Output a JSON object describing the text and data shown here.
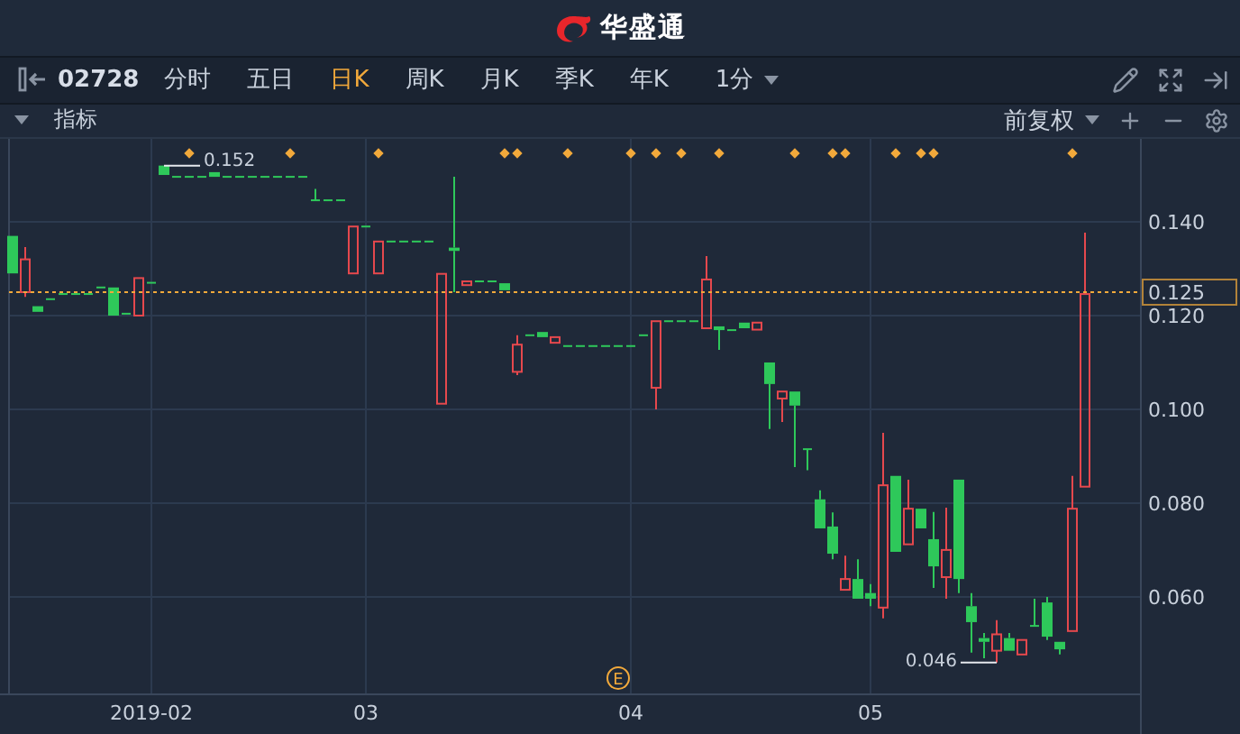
{
  "header": {
    "app_name": "华盛通"
  },
  "toolbar": {
    "symbol": "02728",
    "periods": [
      {
        "label": "分时",
        "selected": false
      },
      {
        "label": "五日",
        "selected": false
      },
      {
        "label": "日K",
        "selected": true
      },
      {
        "label": "周K",
        "selected": false
      },
      {
        "label": "月K",
        "selected": false
      },
      {
        "label": "季K",
        "selected": false
      },
      {
        "label": "年K",
        "selected": false
      }
    ],
    "interval": {
      "label": "1分"
    }
  },
  "indicator_bar": {
    "label": "指标",
    "adjustment": "前复权"
  },
  "chart": {
    "badge_label": "E",
    "chart_data": {
      "type": "candlestick",
      "grid": true,
      "ylim": [
        0.0392,
        0.1577
      ],
      "categories": [
        null,
        null,
        null,
        null,
        null,
        null,
        null,
        null,
        null,
        null,
        null,
        "2019-02",
        null,
        null,
        null,
        null,
        null,
        null,
        null,
        null,
        null,
        null,
        null,
        null,
        null,
        null,
        null,
        null,
        "03",
        null,
        null,
        null,
        null,
        null,
        null,
        null,
        null,
        null,
        null,
        null,
        null,
        null,
        null,
        null,
        null,
        null,
        null,
        null,
        null,
        "04",
        null,
        null,
        null,
        null,
        null,
        null,
        null,
        null,
        null,
        null,
        null,
        null,
        null,
        null,
        null,
        null,
        null,
        null,
        "05",
        null,
        null,
        null,
        null,
        null,
        null,
        null,
        null,
        null,
        null,
        null,
        null,
        null,
        null,
        null,
        null,
        null
      ],
      "yticks": [
        {
          "value": 0.06,
          "label": "0.060"
        },
        {
          "value": 0.08,
          "label": "0.080"
        },
        {
          "value": 0.1,
          "label": "0.100"
        },
        {
          "value": 0.12,
          "label": "0.120"
        },
        {
          "value": 0.14,
          "label": "0.140"
        }
      ],
      "ohlc": [
        [
          0.137,
          0.137,
          0.129,
          0.129
        ],
        [
          0.125,
          0.1346,
          0.124,
          0.132
        ],
        [
          0.122,
          0.122,
          0.1208,
          0.1208
        ],
        [
          0.1235,
          0.1235,
          0.1235,
          0.1235
        ],
        [
          0.1246,
          0.1246,
          0.1246,
          0.1246
        ],
        [
          0.1246,
          0.1246,
          0.1246,
          0.1246
        ],
        [
          0.1246,
          0.1246,
          0.1246,
          0.1246
        ],
        [
          0.126,
          0.126,
          0.126,
          0.126
        ],
        [
          0.126,
          0.126,
          0.12,
          0.12
        ],
        [
          0.1204,
          0.1204,
          0.1204,
          0.1204
        ],
        [
          0.12,
          0.128,
          0.12,
          0.128
        ],
        [
          0.127,
          0.127,
          0.127,
          0.127
        ],
        [
          0.152,
          0.152,
          0.15,
          0.15
        ],
        [
          0.1496,
          0.1496,
          0.1496,
          0.1496
        ],
        [
          0.1496,
          0.1496,
          0.1496,
          0.1496
        ],
        [
          0.1496,
          0.1496,
          0.1496,
          0.1496
        ],
        [
          0.1506,
          0.1506,
          0.1496,
          0.1496
        ],
        [
          0.1496,
          0.1496,
          0.1496,
          0.1496
        ],
        [
          0.1496,
          0.1496,
          0.1496,
          0.1496
        ],
        [
          0.1496,
          0.1496,
          0.1496,
          0.1496
        ],
        [
          0.1496,
          0.1496,
          0.1496,
          0.1496
        ],
        [
          0.1496,
          0.1496,
          0.1496,
          0.1496
        ],
        [
          0.1496,
          0.1496,
          0.1496,
          0.1496
        ],
        [
          0.1496,
          0.1496,
          0.1496,
          0.1496
        ],
        [
          0.1446,
          0.147,
          0.1446,
          0.1446
        ],
        [
          0.1446,
          0.1446,
          0.1446,
          0.1446
        ],
        [
          0.1446,
          0.1446,
          0.1446,
          0.1446
        ],
        [
          0.129,
          0.139,
          0.129,
          0.139
        ],
        [
          0.139,
          0.139,
          0.139,
          0.139
        ],
        [
          0.129,
          0.1358,
          0.129,
          0.1358
        ],
        [
          0.1358,
          0.1358,
          0.1358,
          0.1358
        ],
        [
          0.1358,
          0.1358,
          0.1358,
          0.1358
        ],
        [
          0.1358,
          0.1358,
          0.1358,
          0.1358
        ],
        [
          0.1358,
          0.1358,
          0.1358,
          0.1358
        ],
        [
          0.1012,
          0.1289,
          0.1012,
          0.1289
        ],
        [
          0.1345,
          0.1496,
          0.125,
          0.1338
        ],
        [
          0.1265,
          0.1273,
          0.1265,
          0.1273
        ],
        [
          0.1273,
          0.1273,
          0.1273,
          0.1273
        ],
        [
          0.1273,
          0.1273,
          0.1273,
          0.1273
        ],
        [
          0.1269,
          0.1269,
          0.1254,
          0.1254
        ],
        [
          0.108,
          0.1158,
          0.1073,
          0.1138
        ],
        [
          0.1158,
          0.1158,
          0.1158,
          0.1158
        ],
        [
          0.1165,
          0.1165,
          0.1154,
          0.1154
        ],
        [
          0.1142,
          0.1154,
          0.1142,
          0.1154
        ],
        [
          0.1135,
          0.1135,
          0.1135,
          0.1135
        ],
        [
          0.1135,
          0.1135,
          0.1135,
          0.1135
        ],
        [
          0.1135,
          0.1135,
          0.1135,
          0.1135
        ],
        [
          0.1135,
          0.1135,
          0.1135,
          0.1135
        ],
        [
          0.1135,
          0.1135,
          0.1135,
          0.1135
        ],
        [
          0.1135,
          0.1135,
          0.1135,
          0.1135
        ],
        [
          0.1158,
          0.1158,
          0.1158,
          0.1158
        ],
        [
          0.1046,
          0.1188,
          0.1,
          0.1188
        ],
        [
          0.1188,
          0.1188,
          0.1188,
          0.1188
        ],
        [
          0.1188,
          0.1188,
          0.1188,
          0.1188
        ],
        [
          0.1188,
          0.1188,
          0.1188,
          0.1188
        ],
        [
          0.1173,
          0.1327,
          0.1173,
          0.1277
        ],
        [
          0.1177,
          0.1177,
          0.1127,
          0.1169
        ],
        [
          0.1169,
          0.1169,
          0.1169,
          0.1169
        ],
        [
          0.1185,
          0.1185,
          0.1173,
          0.1173
        ],
        [
          0.117,
          0.1185,
          0.117,
          0.1185
        ],
        [
          0.11,
          0.11,
          0.0958,
          0.1054
        ],
        [
          0.1023,
          0.1038,
          0.0973,
          0.1038
        ],
        [
          0.1038,
          0.1038,
          0.0877,
          0.1008
        ],
        [
          0.0915,
          0.0915,
          0.087,
          0.0915
        ],
        [
          0.0808,
          0.0827,
          0.0746,
          0.0746
        ],
        [
          0.075,
          0.078,
          0.068,
          0.0692
        ],
        [
          0.0615,
          0.0688,
          0.0615,
          0.0638
        ],
        [
          0.0638,
          0.068,
          0.0596,
          0.0596
        ],
        [
          0.0608,
          0.0627,
          0.058,
          0.0596
        ],
        [
          0.0577,
          0.095,
          0.0554,
          0.0838
        ],
        [
          0.0858,
          0.0858,
          0.0696,
          0.0696
        ],
        [
          0.0712,
          0.085,
          0.0712,
          0.0788
        ],
        [
          0.0788,
          0.0788,
          0.0746,
          0.0746
        ],
        [
          0.0723,
          0.0781,
          0.0619,
          0.0665
        ],
        [
          0.0642,
          0.079,
          0.0596,
          0.07
        ],
        [
          0.085,
          0.085,
          0.0608,
          0.0638
        ],
        [
          0.058,
          0.0608,
          0.0481,
          0.0546
        ],
        [
          0.0512,
          0.0523,
          0.0469,
          0.0504
        ],
        [
          0.0485,
          0.055,
          0.046,
          0.052
        ],
        [
          0.0512,
          0.0523,
          0.0485,
          0.0485
        ],
        [
          0.0477,
          0.0508,
          0.0477,
          0.0508
        ],
        [
          0.0538,
          0.0596,
          0.0538,
          0.0538
        ],
        [
          0.0588,
          0.06,
          0.0508,
          0.0515
        ],
        [
          0.0504,
          0.0504,
          0.0477,
          0.0488
        ],
        [
          0.0527,
          0.0858,
          0.0527,
          0.0788
        ],
        [
          0.0835,
          0.1377,
          0.0835,
          0.1246
        ]
      ],
      "ref_lines": [
        {
          "axis": "y",
          "value": 0.125,
          "label": "0.125",
          "color": "#f2a93b"
        }
      ],
      "annotations": [
        "0.152",
        "0.046"
      ]
    }
  }
}
